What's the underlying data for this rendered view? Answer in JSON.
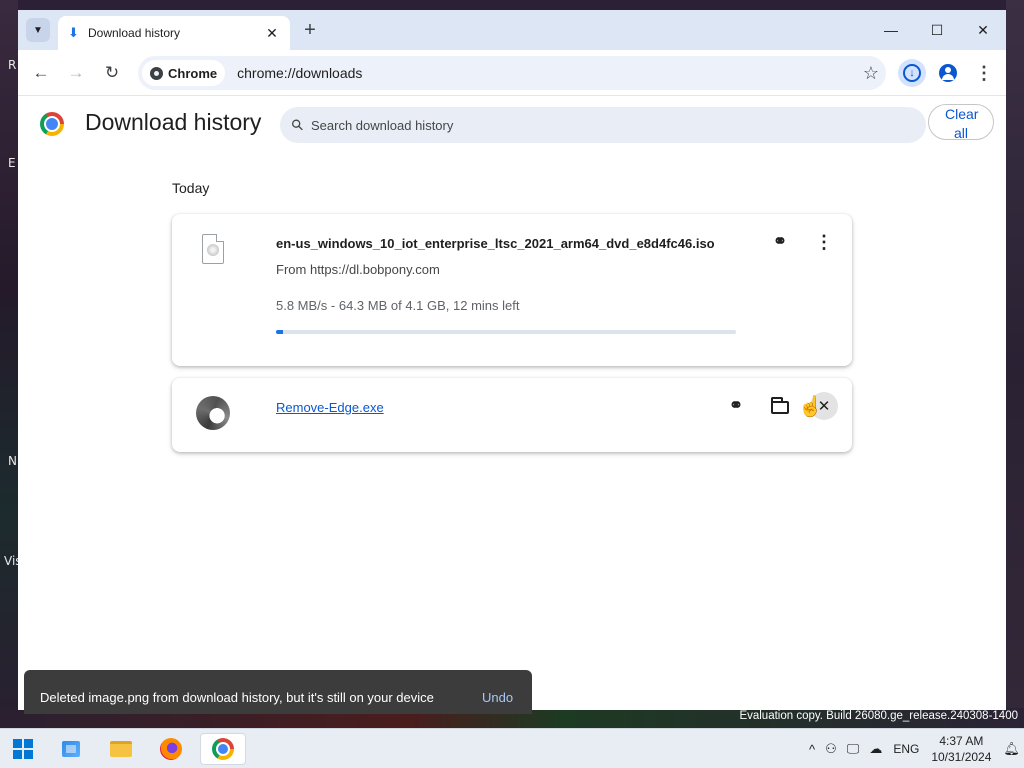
{
  "desktop": {
    "left_letters": [
      "R",
      "E",
      "N",
      "Vis"
    ],
    "evaluation_text": "Evaluation copy. Build 26080.ge_release.240308-1400"
  },
  "browser": {
    "tab": {
      "title": "Download history",
      "icon": "download-icon"
    },
    "window_controls": {
      "minimize": "—",
      "maximize": "☐",
      "close": "✕"
    },
    "toolbar": {
      "back": "←",
      "forward": "→",
      "reload": "↻",
      "site_chip": "Chrome",
      "url": "chrome://downloads",
      "star": "☆",
      "menu": "⋮"
    }
  },
  "page": {
    "title": "Download history",
    "search_placeholder": "Search download history",
    "clear_all": [
      "Clear",
      "all"
    ],
    "date_header": "Today",
    "downloads": [
      {
        "filename": "en-us_windows_10_iot_enterprise_ltsc_2021_arm64_dvd_e8d4fc46.iso",
        "from_label": "From",
        "from_url": "https://dl.bobpony.com",
        "status": "5.8 MB/s - 64.3 MB of 4.1 GB, 12 mins left",
        "progress": 0.015,
        "icon": "file-icon"
      },
      {
        "filename": "Remove-Edge.exe",
        "icon": "edge-icon"
      }
    ],
    "toast": {
      "message": "Deleted image.png from download history, but it's still on your device",
      "action": "Undo"
    }
  },
  "taskbar": {
    "apps": [
      "start",
      "task-view",
      "file-explorer",
      "firefox",
      "chrome"
    ],
    "tray": {
      "chevron": "^",
      "language": "ENG",
      "time": "4:37 AM",
      "date": "10/31/2024"
    }
  },
  "colors": {
    "accent": "#0b57d0",
    "progress": "#1a73e8",
    "titlebar": "#dde6f5",
    "toast_bg": "#3c3c3c"
  }
}
